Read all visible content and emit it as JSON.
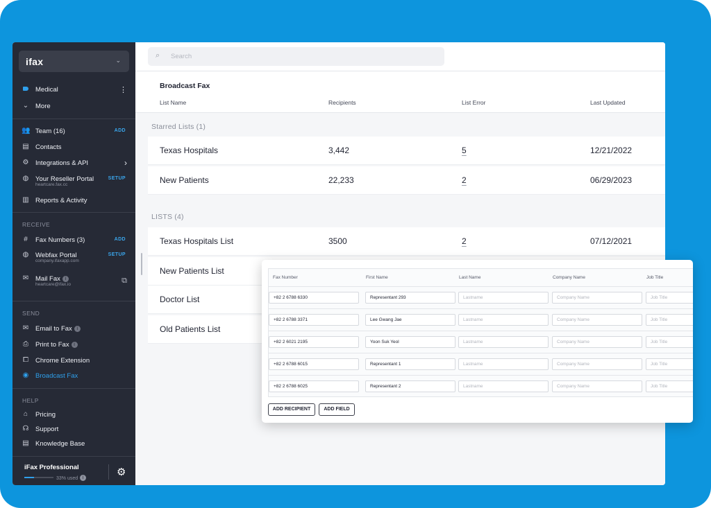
{
  "brand": {
    "logo": "ifax"
  },
  "workspace": {
    "name": "Medical",
    "more": "More"
  },
  "nav": {
    "team": {
      "label": "Team (16)",
      "action": "ADD"
    },
    "contacts": {
      "label": "Contacts"
    },
    "integrations": {
      "label": "Integrations &  API"
    },
    "reseller": {
      "label": "Your Reseller Portal",
      "sub": "heartcare.fax.cc",
      "action": "SETUP"
    },
    "reports": {
      "label": "Reports & Activity"
    }
  },
  "receive": {
    "title": "RECEIVE",
    "fax_numbers": {
      "label": "Fax Numbers (3)",
      "action": "ADD"
    },
    "webfax": {
      "label": "Webfax Portal",
      "sub": "company.ifaxapp.com",
      "action": "SETUP"
    },
    "mail_fax": {
      "label": "Mail Fax",
      "sub": "heartcare@ifax.io"
    }
  },
  "send": {
    "title": "SEND",
    "items": [
      "Email to Fax",
      "Print to Fax",
      "Chrome Extension",
      "Broadcast Fax"
    ]
  },
  "help": {
    "title": "HELP",
    "items": [
      "Pricing",
      "Support",
      "Knowledge Base"
    ]
  },
  "plan": {
    "name": "iFax Professional",
    "usage_text": "33% used",
    "usage_fraction": 0.33
  },
  "search": {
    "placeholder": "Search"
  },
  "broadcast": {
    "title": "Broadcast Fax",
    "columns": [
      "List Name",
      "Recipients",
      "List Error",
      "Last Updated"
    ],
    "starred_label": "Starred Lists (1)",
    "starred": [
      {
        "name": "Texas Hospitals",
        "recipients": "3,442",
        "error": "5",
        "updated": "12/21/2022"
      },
      {
        "name": "New Patients",
        "recipients": "22,233",
        "error": "2",
        "updated": "06/29/2023"
      }
    ],
    "lists_label": "LISTS (4)",
    "lists": [
      {
        "name": "Texas Hospitals List",
        "recipients": "3500",
        "error": "2",
        "updated": "07/12/2021"
      },
      {
        "name": "New Patients List"
      },
      {
        "name": "Doctor List"
      },
      {
        "name": "Old Patients List"
      }
    ]
  },
  "recipients_editor": {
    "columns": [
      "Fax Number",
      "First Name",
      "Last Name",
      "Company Name",
      "Job Title"
    ],
    "placeholders": {
      "last_name": "Lastname",
      "company": "Company Name",
      "job": "Job Title"
    },
    "rows": [
      {
        "fax": "+82 2 6788 6330",
        "first": "Representant 293"
      },
      {
        "fax": "+82 2 6788 3371",
        "first": "Lee Gwang Jae"
      },
      {
        "fax": "+82 2 6021 2195",
        "first": "Yoon Suk Yeol"
      },
      {
        "fax": "+82 2 6788 6015",
        "first": "Representant 1"
      },
      {
        "fax": "+82 2 6788 6025",
        "first": "Representant 2"
      }
    ],
    "add_recipient": "ADD RECIPIENT",
    "add_field": "ADD FIELD"
  },
  "colors": {
    "frame": "#0d95dd",
    "sidebar": "#262a36",
    "accent": "#2fa0ec"
  }
}
